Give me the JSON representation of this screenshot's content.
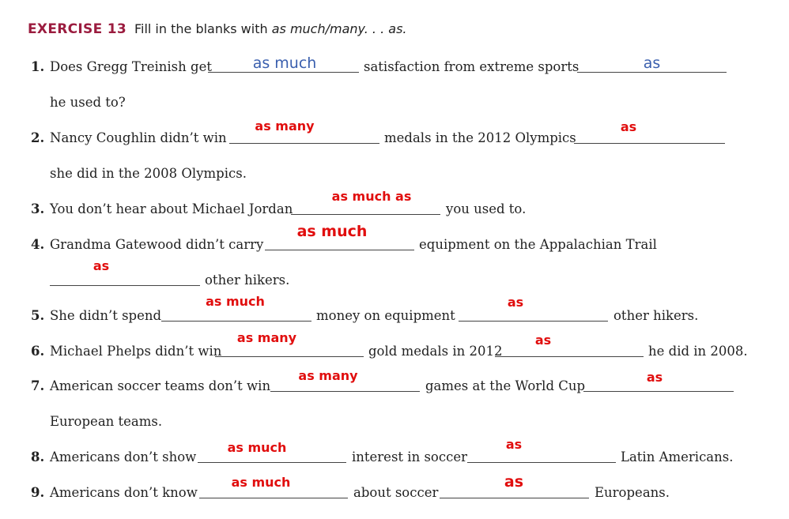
{
  "exercise": {
    "label": "EXERCISE 13",
    "instruction_prefix": "Fill in the blanks with ",
    "instruction_italic": "as much/many. . . as."
  },
  "items": [
    {
      "num": "1.",
      "a": "Does Gregg Treinish get",
      "b": "satisfaction from extreme sports",
      "cont": "he used to?",
      "ans1": "as much",
      "ans2": "as"
    },
    {
      "num": "2.",
      "a": "Nancy Coughlin didn’t win",
      "b": "medals in the 2012 Olympics",
      "cont": "she did in the 2008 Olympics.",
      "ans1": "as many",
      "ans2": "as"
    },
    {
      "num": "3.",
      "a": "You don’t hear about Michael Jordan",
      "b": "you used to.",
      "ans1": "as much as"
    },
    {
      "num": "4.",
      "a": "Grandma Gatewood didn’t carry",
      "b": "equipment on the Appalachian Trail",
      "cont": "other hikers.",
      "ans1": "as much",
      "ans2": "as"
    },
    {
      "num": "5.",
      "a": "She didn’t spend",
      "b": "money on equipment",
      "c": "other hikers.",
      "ans1": "as much",
      "ans2": "as"
    },
    {
      "num": "6.",
      "a": "Michael Phelps didn’t win",
      "b": "gold medals in 2012",
      "c": "he did in 2008.",
      "ans1": "as many",
      "ans2": "as"
    },
    {
      "num": "7.",
      "a": "American soccer teams don’t win",
      "b": "games at the World Cup",
      "cont": "European teams.",
      "ans1": "as many",
      "ans2": "as"
    },
    {
      "num": "8.",
      "a": "Americans don’t show",
      "b": "interest in soccer",
      "c": "Latin Americans.",
      "ans1": "as much",
      "ans2": "as"
    },
    {
      "num": "9.",
      "a": "Americans don’t know",
      "b": "about soccer",
      "c": "Europeans.",
      "ans1": "as much",
      "ans2": "as"
    }
  ],
  "colors": {
    "answer_handwritten": "#3a5fae",
    "answer_typed": "#e10e0e",
    "heading": "#9b1c3f"
  }
}
